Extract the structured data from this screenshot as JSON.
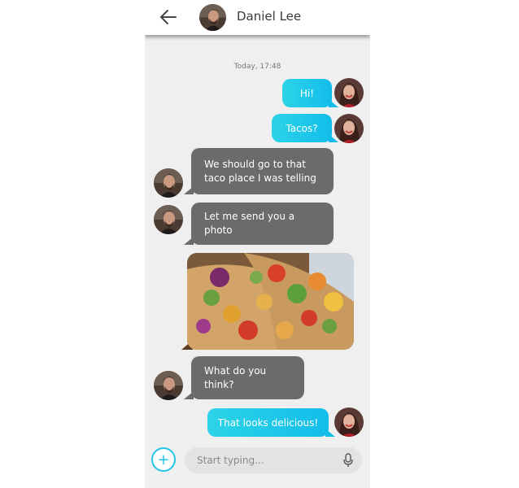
{
  "header": {
    "back_icon": "arrow-left-icon",
    "contact_name": "Daniel Lee"
  },
  "conversation": {
    "timestamp": "Today, 17:48",
    "messages": [
      {
        "sender": "me",
        "text": "Hi!"
      },
      {
        "sender": "me",
        "text": "Tacos?"
      },
      {
        "sender": "contact",
        "lines": [
          "We should go to that",
          "taco place I was telling"
        ]
      },
      {
        "sender": "contact",
        "text": "Let me send you a photo"
      },
      {
        "sender": "contact",
        "type": "photo",
        "alt": "tacos photo"
      },
      {
        "sender": "contact",
        "lines": [
          "What do you",
          "think?"
        ]
      },
      {
        "sender": "me",
        "text": "That looks delicious!"
      }
    ]
  },
  "composer": {
    "add_icon": "plus-icon",
    "add_label": "+",
    "placeholder": "Start typing...",
    "mic_icon": "microphone-icon"
  },
  "colors": {
    "outgoing_bubble_start": "#2cd3e8",
    "outgoing_bubble_end": "#13bdea",
    "incoming_bubble": "#6b6b6b",
    "background": "#efefef",
    "accent": "#22c4ea"
  }
}
